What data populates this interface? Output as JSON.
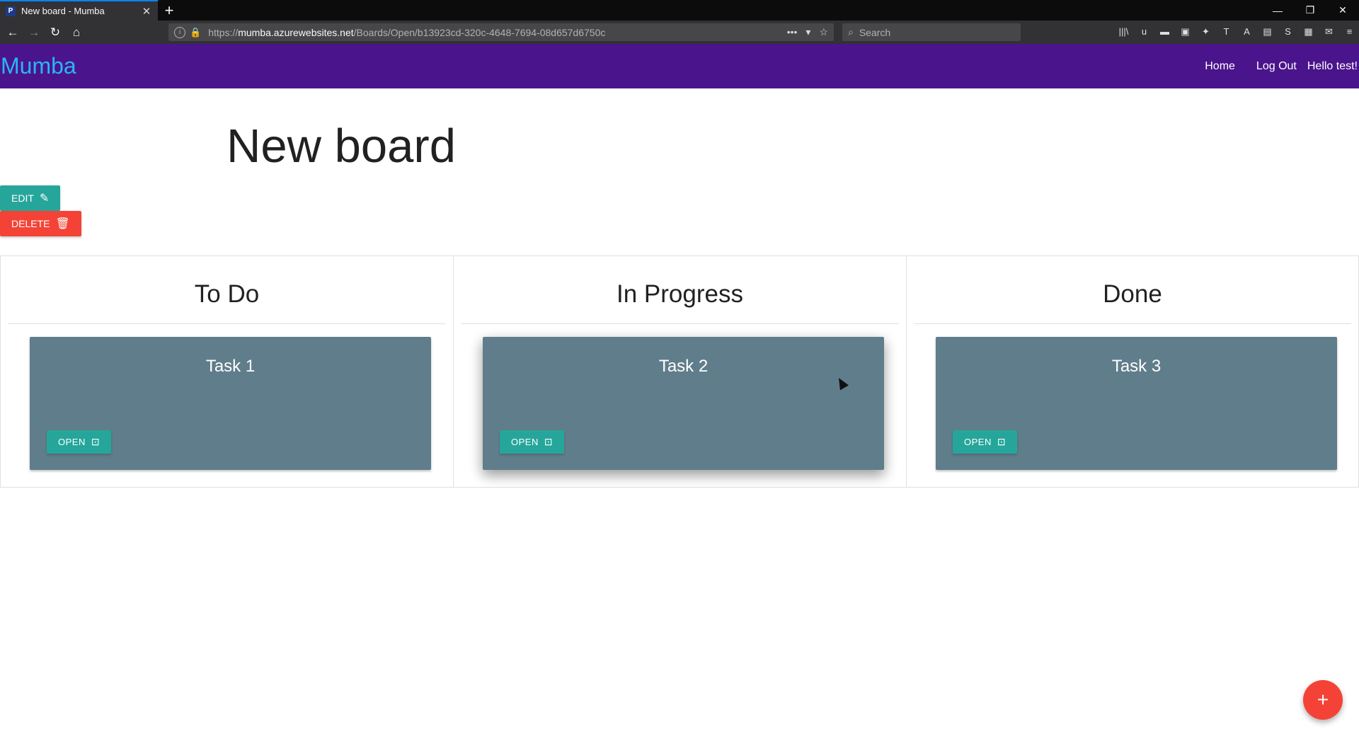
{
  "browser": {
    "tab": {
      "title": "New board - Mumba",
      "favicon": "P",
      "close": "✕"
    },
    "new_tab": "+",
    "window_controls": [
      "—",
      "❐",
      "✕"
    ],
    "nav": {
      "back": "←",
      "forward": "→",
      "reload": "↻",
      "home": "⌂"
    },
    "url": {
      "protocol": "https://",
      "host": "mumba.azurewebsites.net",
      "path": "/Boards/Open/b13923cd-320c-4648-7694-08d657d6750c"
    },
    "url_tools": [
      "•••",
      "▾",
      "☆"
    ],
    "search_placeholder": "Search",
    "extensions": [
      "|||\\",
      "u",
      "▬",
      "▣",
      "✦",
      "T",
      "A",
      "▤",
      "S",
      "▦",
      "✉",
      "≡"
    ]
  },
  "app": {
    "brand": "Mumba",
    "nav": {
      "home": "Home",
      "logout": "Log Out",
      "hello": "Hello test!"
    },
    "accent": "#4a148c"
  },
  "board": {
    "title": "New board",
    "edit_label": "EDIT",
    "edit_icon": "✎",
    "delete_label": "DELETE",
    "delete_icon": "🗑",
    "columns": [
      {
        "title": "To Do",
        "card": {
          "title": "Task 1",
          "open_label": "OPEN",
          "open_icon": "⊡"
        }
      },
      {
        "title": "In Progress",
        "card": {
          "title": "Task 2",
          "open_label": "OPEN",
          "open_icon": "⊡"
        }
      },
      {
        "title": "Done",
        "card": {
          "title": "Task 3",
          "open_label": "OPEN",
          "open_icon": "⊡"
        }
      }
    ],
    "fab_icon": "+"
  }
}
